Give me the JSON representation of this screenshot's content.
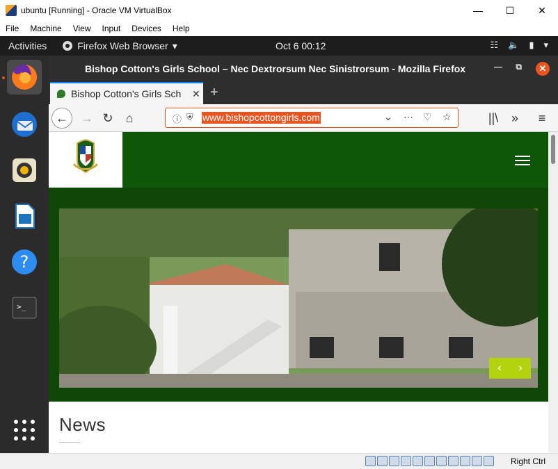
{
  "vbox": {
    "title": "ubuntu [Running] - Oracle VM VirtualBox",
    "menu": [
      "File",
      "Machine",
      "View",
      "Input",
      "Devices",
      "Help"
    ],
    "host_key": "Right Ctrl"
  },
  "gnome": {
    "activities": "Activities",
    "app_menu": "Firefox Web Browser",
    "clock": "Oct 6  00:12"
  },
  "dock": {
    "apps": [
      "firefox-icon",
      "thunderbird-icon",
      "rhythmbox-icon",
      "libreoffice-writer-icon",
      "help-icon",
      "terminal-icon",
      "show-apps-icon"
    ]
  },
  "firefox": {
    "window_title": "Bishop Cotton's Girls School – Nec Dextrorsum Nec Sinistrorsum - Mozilla Firefox",
    "tab_label": "Bishop Cotton's Girls Sch",
    "url": "www.bishopcottongirls.com"
  },
  "page": {
    "news_heading": "News",
    "colors": {
      "header_green": "#0f5708",
      "accent_lime": "#b4d30f"
    }
  }
}
